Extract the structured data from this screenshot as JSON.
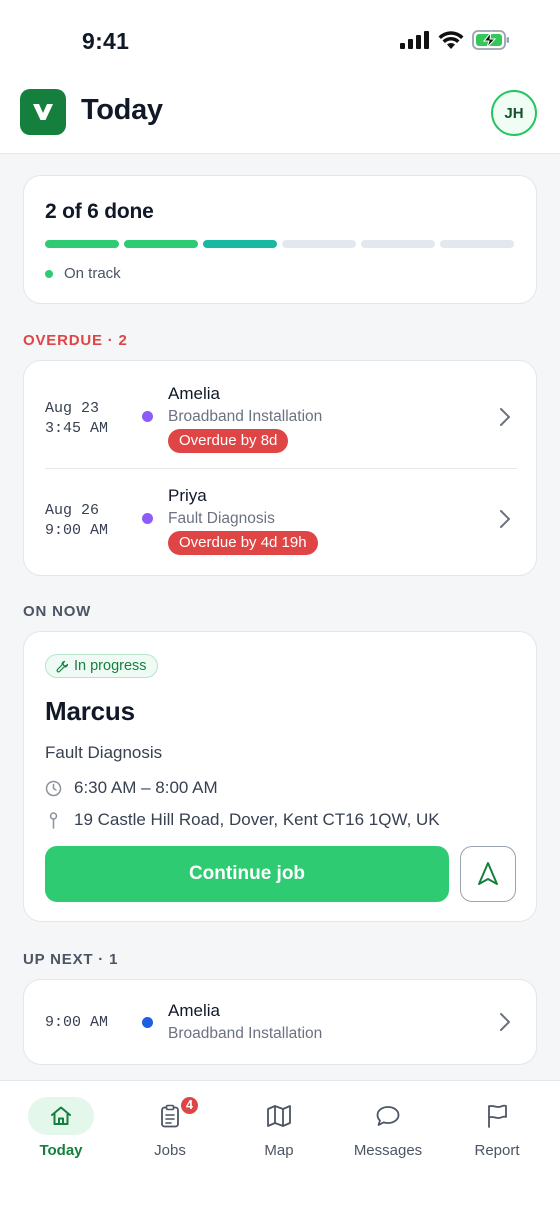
{
  "status_bar": {
    "time": "9:41"
  },
  "header": {
    "title": "Today",
    "avatar_initials": "JH"
  },
  "progress": {
    "title": "2 of 6 done",
    "completed": 2,
    "total": 6,
    "segments": [
      "done",
      "done",
      "active",
      "pending",
      "pending",
      "pending"
    ],
    "status": "On track"
  },
  "overdue": {
    "label": "OVERDUE · 2",
    "jobs": [
      {
        "date": "Aug 23",
        "time": "3:45 AM",
        "customer": "Amelia",
        "service": "Broadband Installation",
        "overdue": "Overdue by 8d"
      },
      {
        "date": "Aug 26",
        "time": "9:00 AM",
        "customer": "Priya",
        "service": "Fault Diagnosis",
        "overdue": "Overdue by 4d 19h"
      }
    ]
  },
  "on_now": {
    "label": "ON NOW",
    "status": "In progress",
    "customer": "Marcus",
    "service": "Fault Diagnosis",
    "time_window": "6:30 AM – 8:00 AM",
    "address": "19 Castle Hill Road, Dover, Kent CT16 1QW, UK",
    "continue_label": "Continue job"
  },
  "up_next": {
    "label": "UP NEXT · 1",
    "jobs": [
      {
        "time": "9:00 AM",
        "customer": "Amelia",
        "service": "Broadband Installation"
      }
    ]
  },
  "nav": {
    "items": [
      {
        "label": "Today",
        "icon": "home-icon",
        "active": true
      },
      {
        "label": "Jobs",
        "icon": "clipboard-icon",
        "badge": "4"
      },
      {
        "label": "Map",
        "icon": "map-icon"
      },
      {
        "label": "Messages",
        "icon": "message-icon"
      },
      {
        "label": "Report",
        "icon": "flag-icon"
      }
    ]
  },
  "colors": {
    "brand": "#15803d",
    "success": "#2fcb72",
    "danger": "#e04545",
    "job_purple": "#8b5cf6",
    "job_blue": "#1d5fe0",
    "teal": "#19b8a0"
  }
}
